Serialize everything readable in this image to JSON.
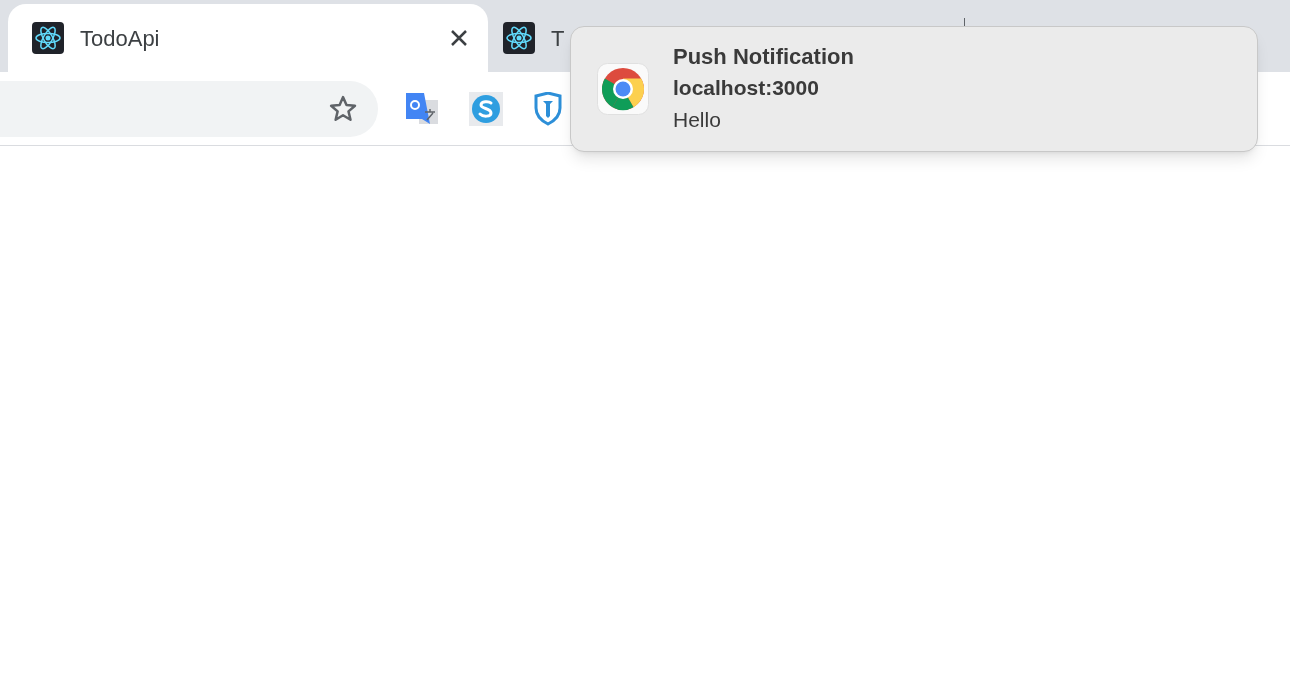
{
  "tabs": [
    {
      "title": "TodoApi",
      "selected": true,
      "closable": true
    },
    {
      "title": "T",
      "selected": false,
      "closable": false
    }
  ],
  "notification": {
    "title": "Push Notification",
    "origin": "localhost:3000",
    "body": "Hello"
  }
}
